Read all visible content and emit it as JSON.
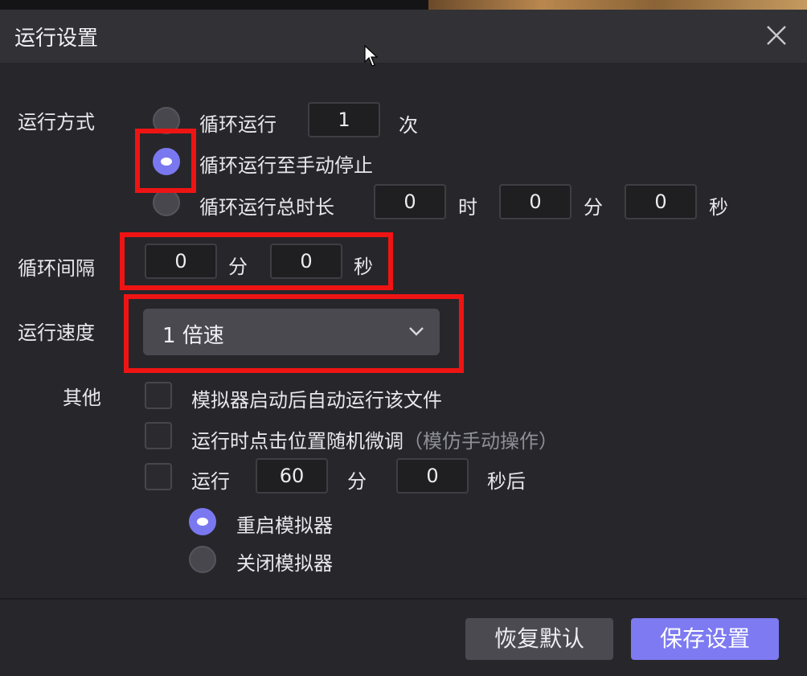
{
  "dialog": {
    "title": "运行设置"
  },
  "run_mode": {
    "label": "运行方式",
    "options": [
      {
        "label": "循环运行",
        "selected": false
      },
      {
        "label": "循环运行至手动停止",
        "selected": true
      },
      {
        "label": "循环运行总时长",
        "selected": false
      }
    ],
    "loop_count": "1",
    "loop_count_unit": "次",
    "duration": {
      "hours": "0",
      "hours_unit": "时",
      "minutes": "0",
      "minutes_unit": "分",
      "seconds": "0",
      "seconds_unit": "秒"
    }
  },
  "interval": {
    "label": "循环间隔",
    "minutes": "0",
    "minutes_unit": "分",
    "seconds": "0",
    "seconds_unit": "秒"
  },
  "speed": {
    "label": "运行速度",
    "selected": "1 倍速"
  },
  "other": {
    "label": "其他",
    "options": [
      {
        "label": "模拟器启动后自动运行该文件",
        "checked": false
      },
      {
        "label": "运行时点击位置随机微调",
        "hint": "（模仿手动操作）",
        "checked": false
      },
      {
        "label": "运行",
        "checked": false
      }
    ],
    "after_minutes": "60",
    "after_minutes_unit": "分",
    "after_seconds": "0",
    "after_seconds_unit": "秒后",
    "after_actions": [
      {
        "label": "重启模拟器",
        "selected": true
      },
      {
        "label": "关闭模拟器",
        "selected": false
      }
    ]
  },
  "buttons": {
    "reset": "恢复默认",
    "save": "保存设置"
  },
  "colors": {
    "accent": "#7d7af2",
    "highlight": "#ef1414",
    "background": "#27272b"
  },
  "icons": [
    "close-icon",
    "chevron-down-icon",
    "mouse-cursor-icon"
  ]
}
